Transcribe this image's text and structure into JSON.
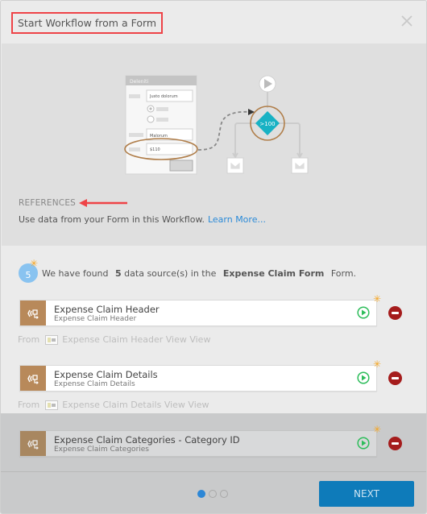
{
  "dialog": {
    "title": "Start Workflow from a Form",
    "close_icon": "close-icon"
  },
  "illustration": {
    "form_title": "Deleniti",
    "field1_value": "Justo dolorum",
    "field2_value": "Malorum",
    "field3_value": "$110",
    "condition_label": ">100"
  },
  "intro": {
    "section_label": "REFERENCES",
    "description": "Use data from your Form in this Workflow.",
    "learn_more": "Learn More..."
  },
  "summary": {
    "count": "5",
    "prefix": "We have found",
    "count_bold": "5",
    "middle": "data source(s) in the",
    "form_name": "Expense Claim Form",
    "suffix": "Form."
  },
  "data_sources": [
    {
      "name": "Expense Claim Header",
      "subtitle": "Expense Claim Header",
      "from_label": "From",
      "from_view": "Expense Claim Header View View"
    },
    {
      "name": "Expense Claim Details",
      "subtitle": "Expense Claim Details",
      "from_label": "From",
      "from_view": "Expense Claim Details View View"
    },
    {
      "name": "Expense Claim Categories - Category ID",
      "subtitle": "Expense Claim Categories"
    }
  ],
  "footer": {
    "pages": 3,
    "current_page": 1,
    "next_label": "NEXT"
  },
  "colors": {
    "accent_blue": "#0e7bba",
    "link_blue": "#2a8ad8",
    "source_icon_bg": "#b8895a",
    "remove_red": "#a51c1c",
    "run_green": "#2ebd5b",
    "star_orange": "#f5a623",
    "highlight_red": "#ee4347"
  }
}
